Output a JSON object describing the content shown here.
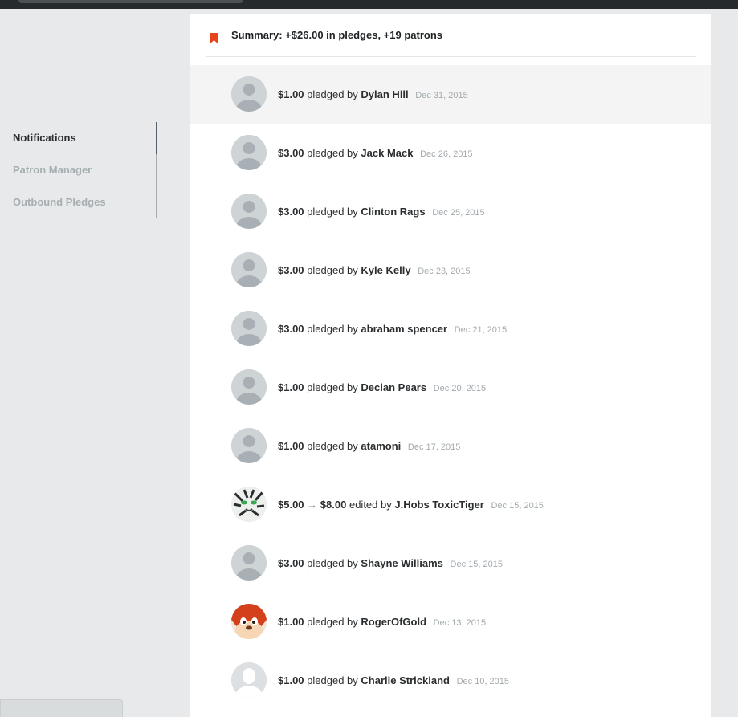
{
  "sidebar": {
    "items": [
      {
        "label": "Notifications",
        "active": true
      },
      {
        "label": "Patron Manager",
        "active": false
      },
      {
        "label": "Outbound Pledges",
        "active": false
      }
    ]
  },
  "summary": {
    "icon": "bookmark-icon",
    "text": "Summary: +$26.00 in pledges, +19 patrons"
  },
  "feed": [
    {
      "amount": "$1.00",
      "verb": "pledged by",
      "name": "Dylan Hill",
      "date": "Dec 31, 2015",
      "avatar": "default-avatar"
    },
    {
      "amount": "$3.00",
      "verb": "pledged by",
      "name": "Jack Mack",
      "date": "Dec 26, 2015",
      "avatar": "default-avatar"
    },
    {
      "amount": "$3.00",
      "verb": "pledged by",
      "name": "Clinton Rags",
      "date": "Dec 25, 2015",
      "avatar": "default-avatar"
    },
    {
      "amount": "$3.00",
      "verb": "pledged by",
      "name": "Kyle Kelly",
      "date": "Dec 23, 2015",
      "avatar": "default-avatar"
    },
    {
      "amount": "$3.00",
      "verb": "pledged by",
      "name": "abraham spencer",
      "date": "Dec 21, 2015",
      "avatar": "default-avatar"
    },
    {
      "amount": "$1.00",
      "verb": "pledged by",
      "name": "Declan Pears",
      "date": "Dec 20, 2015",
      "avatar": "default-avatar"
    },
    {
      "amount": "$1.00",
      "verb": "pledged by",
      "name": "atamoni",
      "date": "Dec 17, 2015",
      "avatar": "default-avatar"
    },
    {
      "amount": "$5.00",
      "arrow": "→",
      "amount_new": "$8.00",
      "verb": "edited by",
      "name": "J.Hobs ToxicTiger",
      "date": "Dec 15, 2015",
      "avatar": "tiger-avatar"
    },
    {
      "amount": "$3.00",
      "verb": "pledged by",
      "name": "Shayne Williams",
      "date": "Dec 15, 2015",
      "avatar": "default-avatar"
    },
    {
      "amount": "$1.00",
      "verb": "pledged by",
      "name": "RogerOfGold",
      "date": "Dec 13, 2015",
      "avatar": "fox-avatar"
    },
    {
      "amount": "$1.00",
      "verb": "pledged by",
      "name": "Charlie Strickland",
      "date": "Dec 10, 2015",
      "avatar": "silhouette-avatar"
    }
  ],
  "colors": {
    "accent": "#e8431b",
    "page_bg": "#e7e9ea",
    "topbar": "#262a2c",
    "highlight_row": "#f4f4f4",
    "muted_text": "#a7aeb2"
  }
}
